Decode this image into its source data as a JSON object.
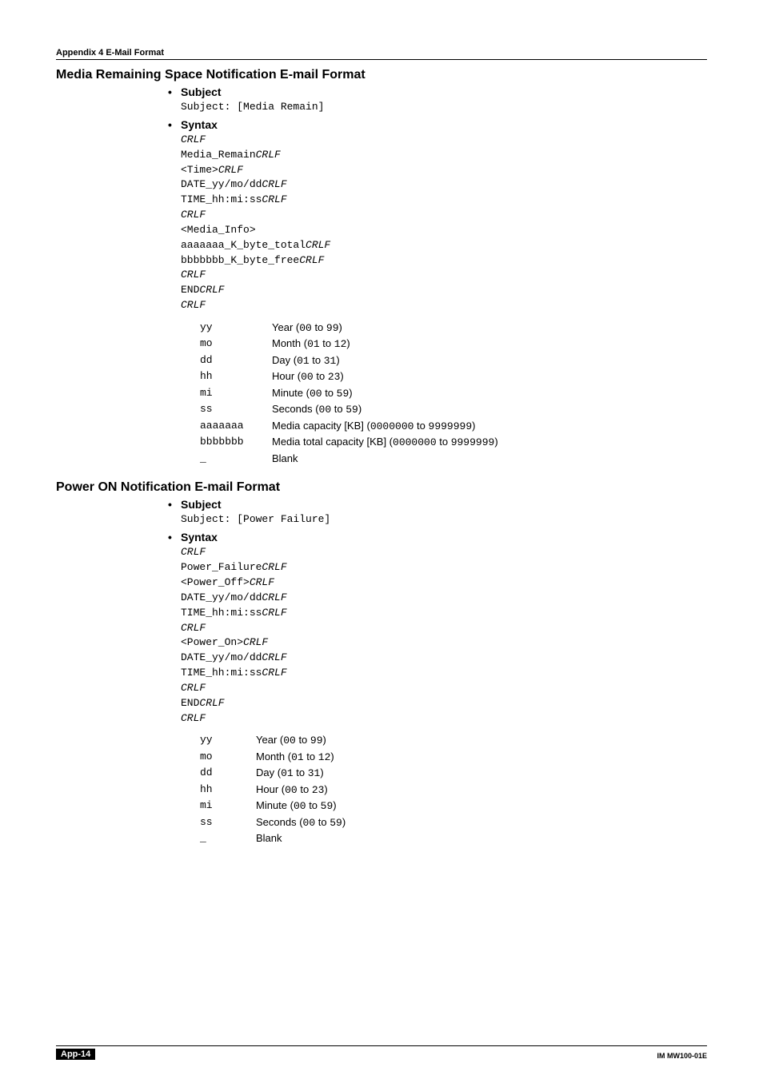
{
  "header": "Appendix 4  E-Mail Format",
  "section1": {
    "title": "Media Remaining Space Notification E-mail Format",
    "subject_label": "Subject",
    "subject_line": "Subject: [Media Remain]",
    "syntax_label": "Syntax",
    "syntax_lines": [
      {
        "t": "CRLF",
        "i": true
      },
      {
        "pre": "Media_Remain",
        "suf": "CRLF"
      },
      {
        "pre": "<Time>",
        "suf": "CRLF"
      },
      {
        "pre": "DATE_yy/mo/dd",
        "suf": "CRLF"
      },
      {
        "pre": "TIME_hh:mi:ss",
        "suf": "CRLF"
      },
      {
        "t": "CRLF",
        "i": true
      },
      {
        "pre": "<Media_Info>"
      },
      {
        "pre": "aaaaaaa_K_byte_total",
        "suf": "CRLF"
      },
      {
        "pre": "bbbbbbb_K_byte_free",
        "suf": "CRLF"
      },
      {
        "t": "CRLF",
        "i": true
      },
      {
        "pre": "END",
        "suf": "CRLF"
      },
      {
        "t": "CRLF",
        "i": true
      }
    ],
    "desc": [
      {
        "k": "yy",
        "pre": "Year (",
        "m": "00",
        "mid": " to ",
        "m2": "99",
        "post": ")"
      },
      {
        "k": "mo",
        "pre": "Month (",
        "m": "01",
        "mid": " to ",
        "m2": "12",
        "post": ")"
      },
      {
        "k": "dd",
        "pre": "Day (",
        "m": "01",
        "mid": " to ",
        "m2": "31",
        "post": ")"
      },
      {
        "k": "hh",
        "pre": "Hour (",
        "m": "00",
        "mid": " to ",
        "m2": "23",
        "post": ")"
      },
      {
        "k": "mi",
        "pre": "Minute (",
        "m": "00",
        "mid": " to ",
        "m2": "59",
        "post": ")"
      },
      {
        "k": "ss",
        "pre": "Seconds (",
        "m": "00",
        "mid": " to ",
        "m2": "59",
        "post": ")"
      },
      {
        "k": "aaaaaaa",
        "pre": "Media capacity [KB] (",
        "m": "0000000",
        "mid": " to ",
        "m2": "9999999",
        "post": ")"
      },
      {
        "k": "bbbbbbb",
        "pre": "Media total capacity [KB] (",
        "m": "0000000",
        "mid": " to ",
        "m2": "9999999",
        "post": ")"
      },
      {
        "k": "_",
        "pre": "Blank"
      }
    ]
  },
  "section2": {
    "title": "Power ON Notification E-mail Format",
    "subject_label": "Subject",
    "subject_line": "Subject: [Power Failure]",
    "syntax_label": "Syntax",
    "syntax_lines": [
      {
        "t": "CRLF",
        "i": true
      },
      {
        "pre": "Power_Failure",
        "suf": "CRLF"
      },
      {
        "pre": "<Power_Off>",
        "suf": "CRLF"
      },
      {
        "pre": "DATE_yy/mo/dd",
        "suf": "CRLF"
      },
      {
        "pre": "TIME_hh:mi:ss",
        "suf": "CRLF"
      },
      {
        "t": "CRLF",
        "i": true
      },
      {
        "pre": "<Power_On>",
        "suf": "CRLF"
      },
      {
        "pre": "DATE_yy/mo/dd",
        "suf": "CRLF"
      },
      {
        "pre": "TIME_hh:mi:ss",
        "suf": "CRLF"
      },
      {
        "t": "CRLF",
        "i": true
      },
      {
        "pre": "END",
        "suf": "CRLF"
      },
      {
        "t": "CRLF",
        "i": true
      }
    ],
    "desc": [
      {
        "k": "yy",
        "pre": "Year (",
        "m": "00",
        "mid": " to ",
        "m2": "99",
        "post": ")"
      },
      {
        "k": "mo",
        "pre": "Month (",
        "m": "01",
        "mid": " to ",
        "m2": "12",
        "post": ")"
      },
      {
        "k": "dd",
        "pre": "Day (",
        "m": "01",
        "mid": " to ",
        "m2": "31",
        "post": ")"
      },
      {
        "k": "hh",
        "pre": "Hour (",
        "m": "00",
        "mid": " to ",
        "m2": "23",
        "post": ")"
      },
      {
        "k": "mi",
        "pre": "Minute (",
        "m": "00",
        "mid": " to ",
        "m2": "59",
        "post": ")"
      },
      {
        "k": "ss",
        "pre": "Seconds (",
        "m": "00",
        "mid": " to ",
        "m2": "59",
        "post": ")"
      },
      {
        "k": "_",
        "pre": "Blank"
      }
    ]
  },
  "footer": {
    "page": "App-14",
    "doc": "IM MW100-01E"
  }
}
